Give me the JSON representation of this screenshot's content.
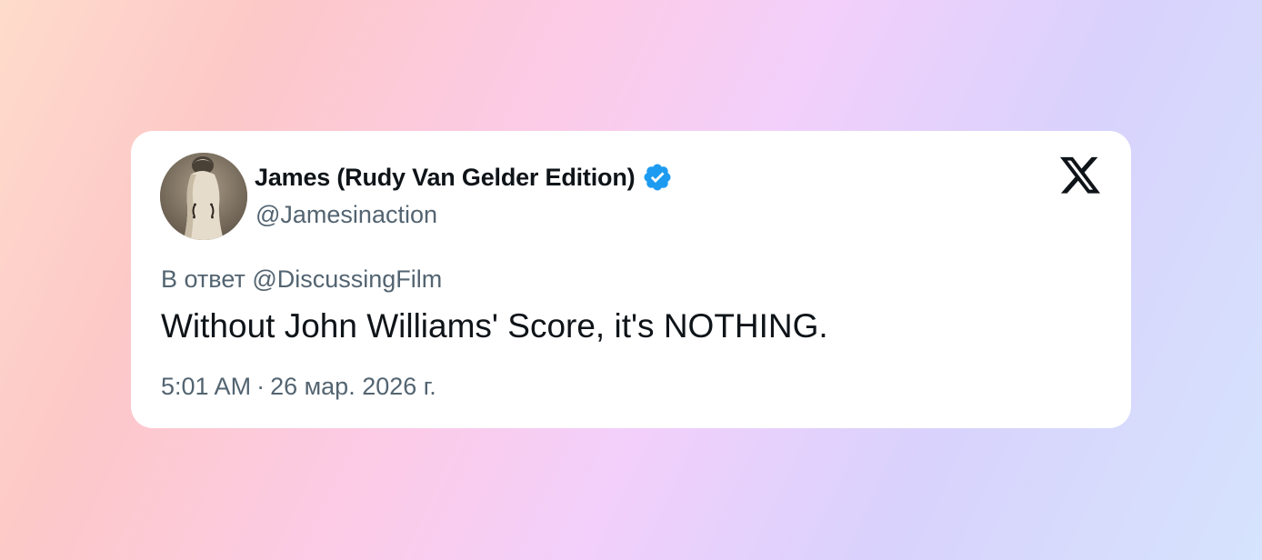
{
  "tweet": {
    "display_name": "James (Rudy Van Gelder Edition)",
    "handle": "@Jamesinaction",
    "verified_icon": "verified-badge-icon",
    "platform_icon": "x-logo-icon",
    "reply_to": "В ответ @DiscussingFilm",
    "text": "Without John Williams' Score, it's NOTHING.",
    "time": "5:01 AM",
    "separator": "·",
    "date": "26 мар. 2026 г."
  },
  "colors": {
    "text_primary": "#0f1419",
    "text_secondary": "#536471",
    "verified_blue": "#1d9bf0",
    "card_background": "#ffffff"
  }
}
